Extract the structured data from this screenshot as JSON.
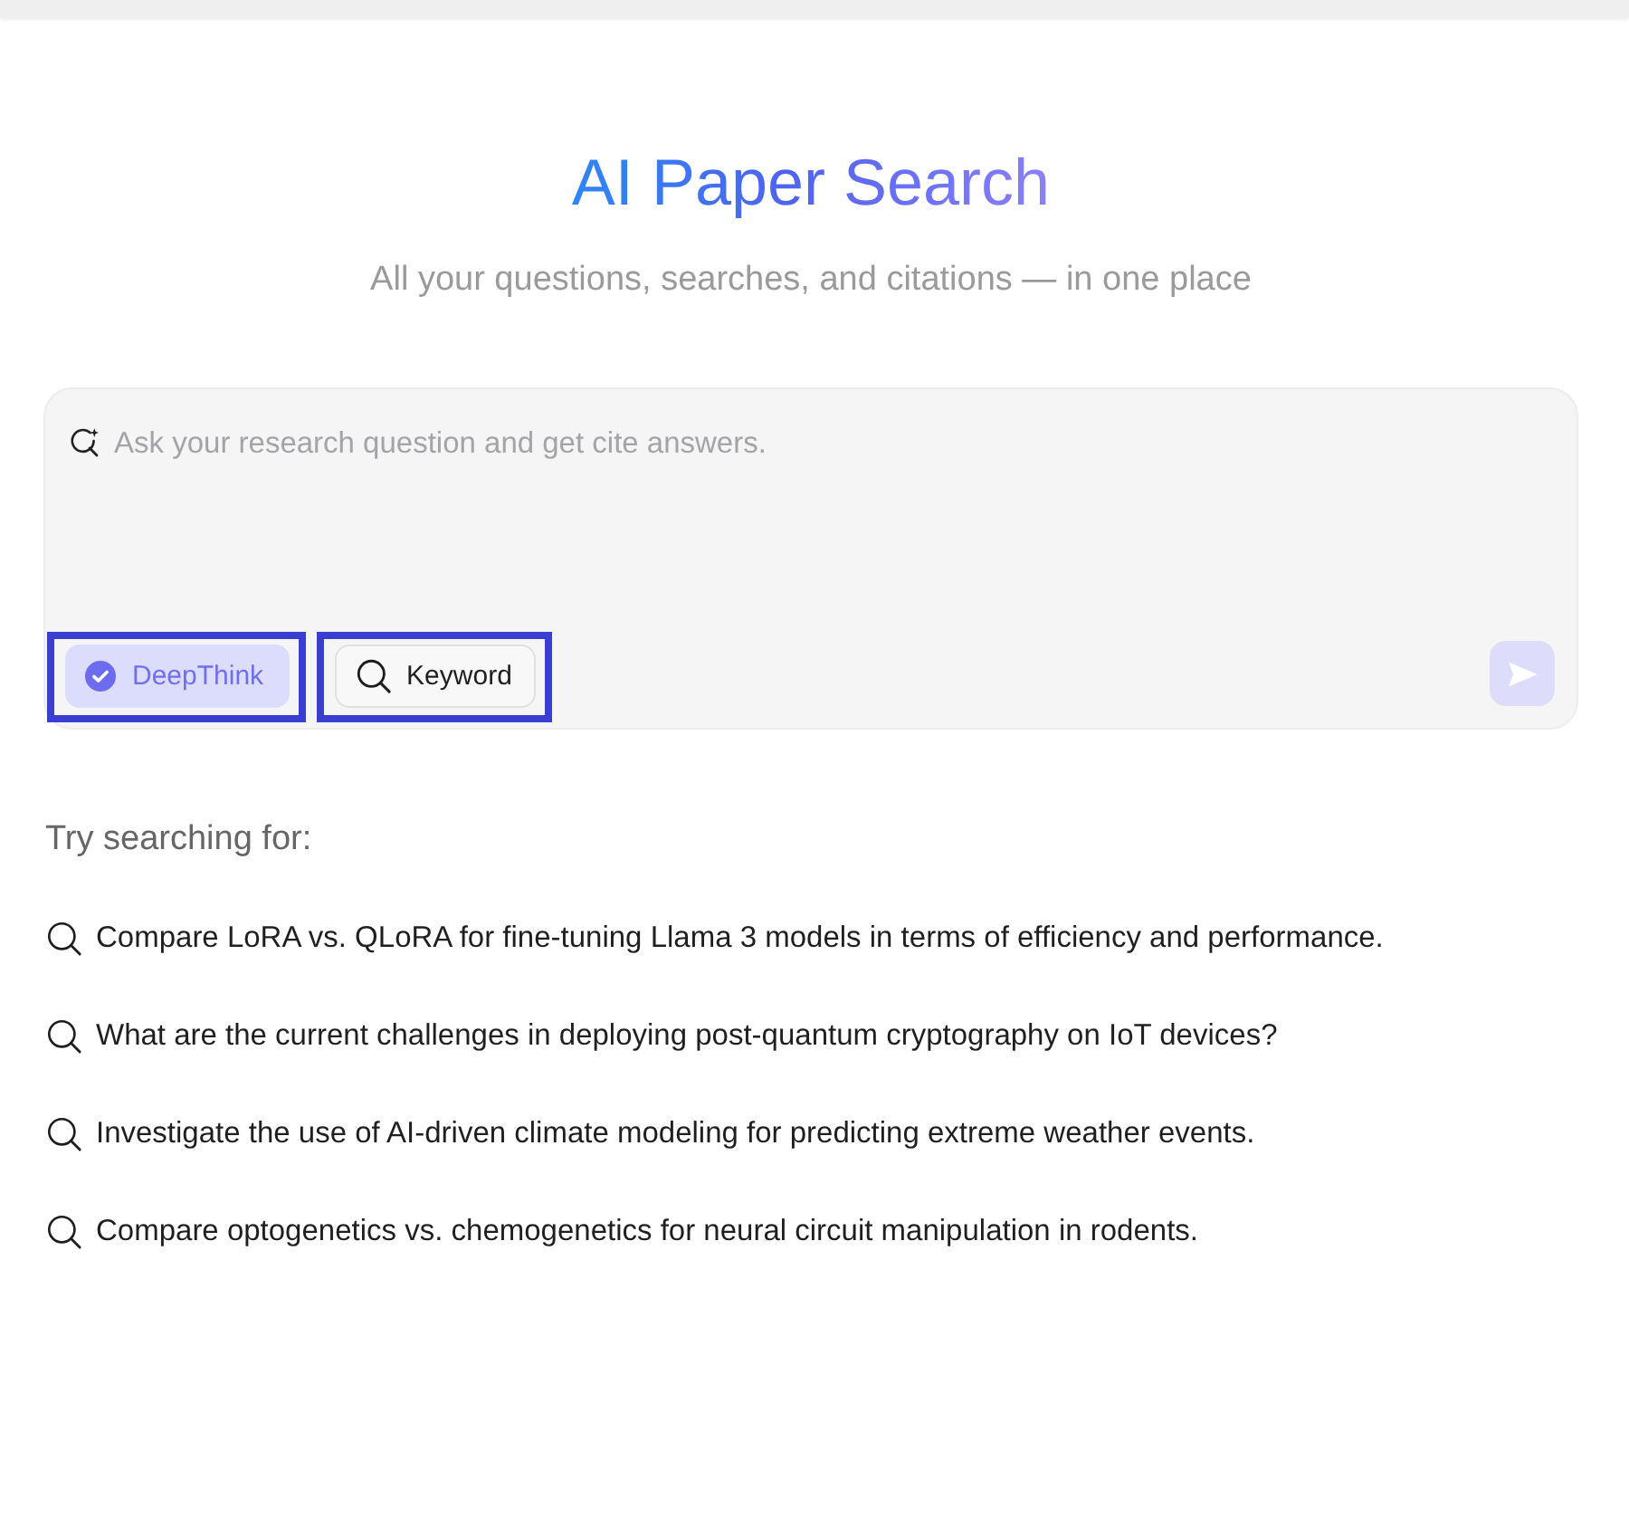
{
  "header": {
    "title": "AI Paper Search",
    "subtitle": "All your questions, searches, and citations — in one place"
  },
  "search": {
    "placeholder": "Ask your research question and get cite answers.",
    "modes": [
      {
        "label": "DeepThink",
        "kind": "toggle",
        "selected": true,
        "highlighted": true
      },
      {
        "label": "Keyword",
        "kind": "search",
        "selected": false,
        "highlighted": true
      }
    ],
    "send_button": {
      "disabled": true
    }
  },
  "suggestions": {
    "heading": "Try searching for:",
    "items": [
      "Compare LoRA vs. QLoRA for fine-tuning Llama 3 models in terms of efficiency and performance.",
      "What are the current challenges in deploying post-quantum cryptography on IoT devices?",
      "Investigate the use of AI-driven climate modeling for predicting extreme weather events.",
      "Compare optogenetics vs. chemogenetics for neural circuit manipulation in rodents."
    ]
  }
}
